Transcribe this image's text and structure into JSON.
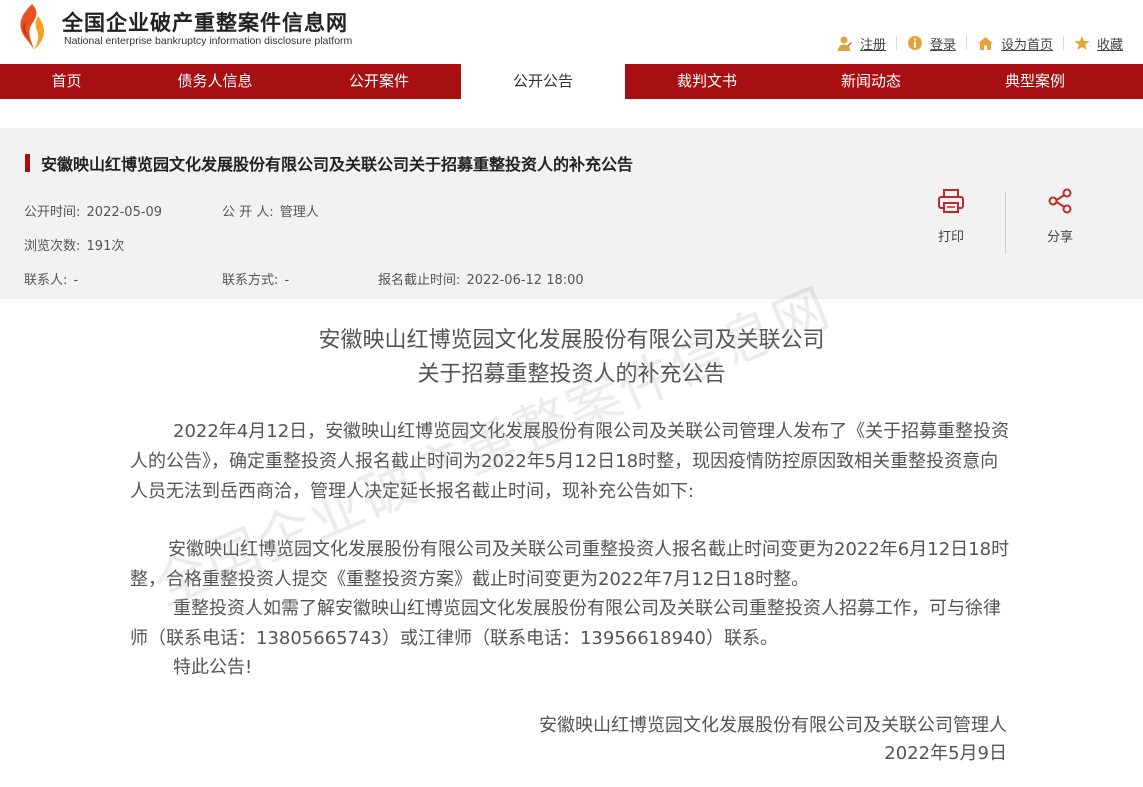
{
  "site": {
    "title": "全国企业破产重整案件信息网",
    "subtitle": "National enterprise bankruptcy  information disclosure platform"
  },
  "top_links": {
    "register": "注册",
    "login": "登录",
    "set_home": "设为首页",
    "favorite": "收藏"
  },
  "nav": {
    "items": [
      "首页",
      "债务人信息",
      "公开案件",
      "公开公告",
      "裁判文书",
      "新闻动态",
      "典型案例"
    ],
    "active": "公开公告"
  },
  "announcement": {
    "title": "安徽映山红博览园文化发展股份有限公司及关联公司关于招募重整投资人的补充公告",
    "publish_time_label": "公开时间:",
    "publish_time": "2022-05-09",
    "publisher_label": "公 开 人:",
    "publisher": "管理人",
    "views_label": "浏览次数:",
    "views": "191次",
    "contact_label": "联系人:",
    "contact": "-",
    "contact_method_label": "联系方式:",
    "contact_method": "-",
    "deadline_label": "报名截止时间:",
    "deadline": "2022-06-12 18:00"
  },
  "tools": {
    "print": "打印",
    "share": "分享"
  },
  "document": {
    "heading_line1": "安徽映山红博览园文化发展股份有限公司及关联公司",
    "heading_line2": "关于招募重整投资人的补充公告",
    "para1": "2022年4月12日，安徽映山红博览园文化发展股份有限公司及关联公司管理人发布了《关于招募重整投资人的公告》，确定重整投资人报名截止时间为2022年5月12日18时整，现因疫情防控原因致相关重整投资意向人员无法到岳西商洽，管理人决定延长报名截止时间，现补充公告如下:",
    "para2": "安徽映山红博览园文化发展股份有限公司及关联公司重整投资人报名截止时间变更为2022年6月12日18时整，合格重整投资人提交《重整投资方案》截止时间变更为2022年7月12日18时整。",
    "para3": "重整投资人如需了解安徽映山红博览园文化发展股份有限公司及关联公司重整投资人招募工作，可与徐律师（联系电话：13805665743）或江律师（联系电话：13956618940）联系。",
    "para4": "特此公告!",
    "signature": "安徽映山红博览园文化发展股份有限公司及关联公司管理人",
    "date": "2022年5月9日"
  },
  "watermark": "全国企业破产重整案件信息网",
  "colors": {
    "brand_red": "#a80f12",
    "logo_orange": "#f08a24",
    "panel_bg": "#f2f2f2"
  },
  "icons": [
    "logo-flame-icon",
    "register-user-icon",
    "login-info-icon",
    "home-icon",
    "star-icon",
    "printer-icon",
    "share-icon"
  ]
}
